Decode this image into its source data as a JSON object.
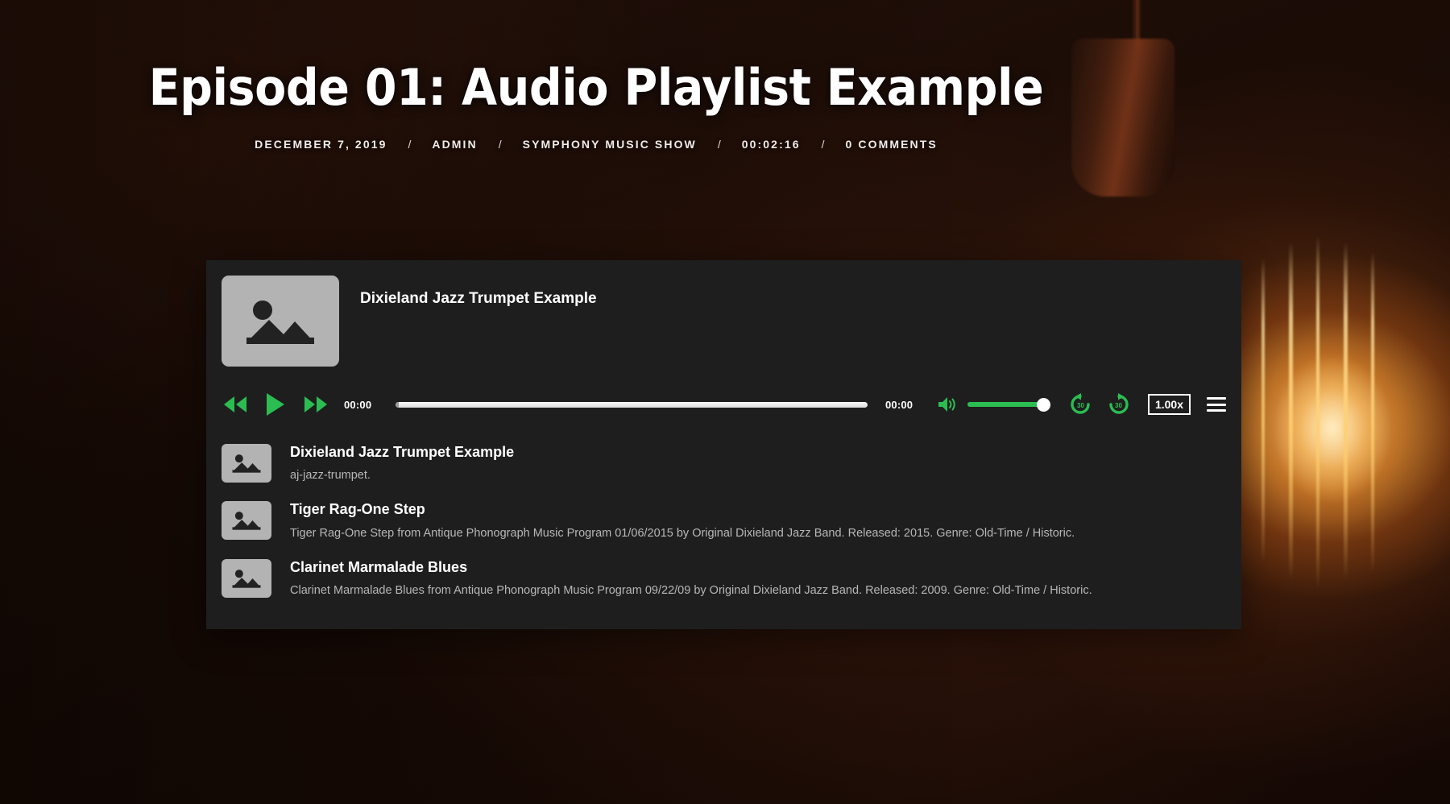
{
  "header": {
    "title": "Episode 01: Audio Playlist Example",
    "meta": [
      {
        "label": "DECEMBER 7, 2019",
        "name": "post-date"
      },
      {
        "label": "ADMIN",
        "name": "post-author"
      },
      {
        "label": "SYMPHONY MUSIC SHOW",
        "name": "post-category"
      },
      {
        "label": "00:02:16",
        "name": "post-duration"
      },
      {
        "label": "0 COMMENTS",
        "name": "post-comments"
      }
    ],
    "separator": "/"
  },
  "player": {
    "now_playing_title": "Dixieland Jazz Trumpet Example",
    "artwork_icon": "image-placeholder-icon",
    "controls": {
      "rewind_icon": "rewind-icon",
      "play_icon": "play-icon",
      "fast_forward_icon": "fast-forward-icon",
      "current_time": "00:00",
      "duration_time": "00:00",
      "progress_percent": 0,
      "volume_icon": "volume-icon",
      "volume_percent": 100,
      "skip_back_icon": "replay-30-icon",
      "skip_back_label": "30",
      "skip_forward_icon": "forward-30-icon",
      "skip_forward_label": "30",
      "speed_label": "1.00x",
      "menu_icon": "hamburger-menu-icon"
    },
    "accent_color": "#2bbd52",
    "panel_color": "#1e1e1e"
  },
  "playlist": [
    {
      "title": "Dixieland Jazz Trumpet Example",
      "description": "aj-jazz-trumpet.",
      "thumb_icon": "image-placeholder-icon"
    },
    {
      "title": "Tiger Rag-One Step",
      "description": "Tiger Rag-One Step from Antique Phonograph Music Program 01/06/2015 by Original Dixieland Jazz Band. Released: 2015. Genre: Old-Time / Historic.",
      "thumb_icon": "image-placeholder-icon"
    },
    {
      "title": "Clarinet Marmalade Blues",
      "description": "Clarinet Marmalade Blues from Antique Phonograph Music Program 09/22/09 by Original Dixieland Jazz Band. Released: 2009. Genre: Old-Time / Historic.",
      "thumb_icon": "image-placeholder-icon"
    }
  ]
}
